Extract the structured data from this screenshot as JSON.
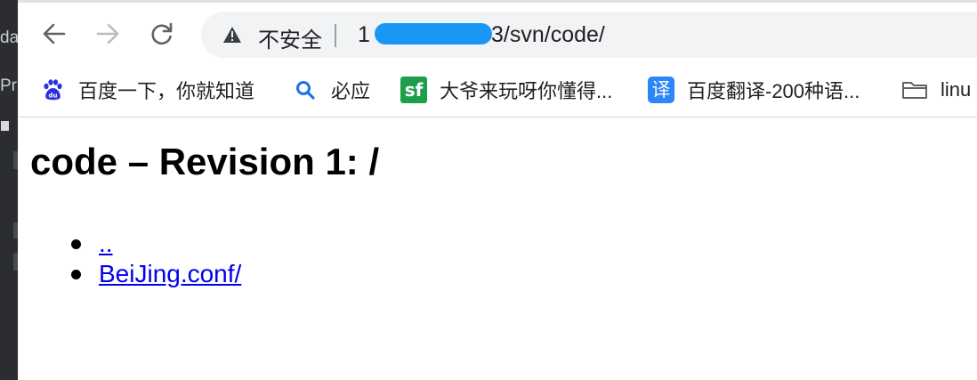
{
  "background_window": {
    "fragment_1": "da",
    "fragment_2": "Pr"
  },
  "browser": {
    "address_bar": {
      "security_label": "不安全",
      "url_prefix": "1",
      "url_suffix": "3/svn/code/"
    },
    "bookmarks": [
      {
        "label": "百度一下，你就知道",
        "icon": "baidu-paw-icon"
      },
      {
        "label": "必应",
        "icon": "search-icon"
      },
      {
        "label": "大爷来玩呀你懂得...",
        "icon": "sf-icon",
        "icon_text": "sf"
      },
      {
        "label": "百度翻译-200种语...",
        "icon": "translate-icon",
        "icon_text": "译"
      },
      {
        "label": "linu",
        "icon": "folder-icon"
      }
    ]
  },
  "page": {
    "title": "code – Revision 1: /",
    "entries": [
      {
        "label": ".."
      },
      {
        "label": "BeiJing.conf/"
      }
    ]
  },
  "colors": {
    "link": "#0000ee",
    "redaction": "#1a97f5",
    "sf_icon": "#1e9e4a",
    "translate_icon": "#2d86f5",
    "baidu_icon": "#2932e1"
  }
}
